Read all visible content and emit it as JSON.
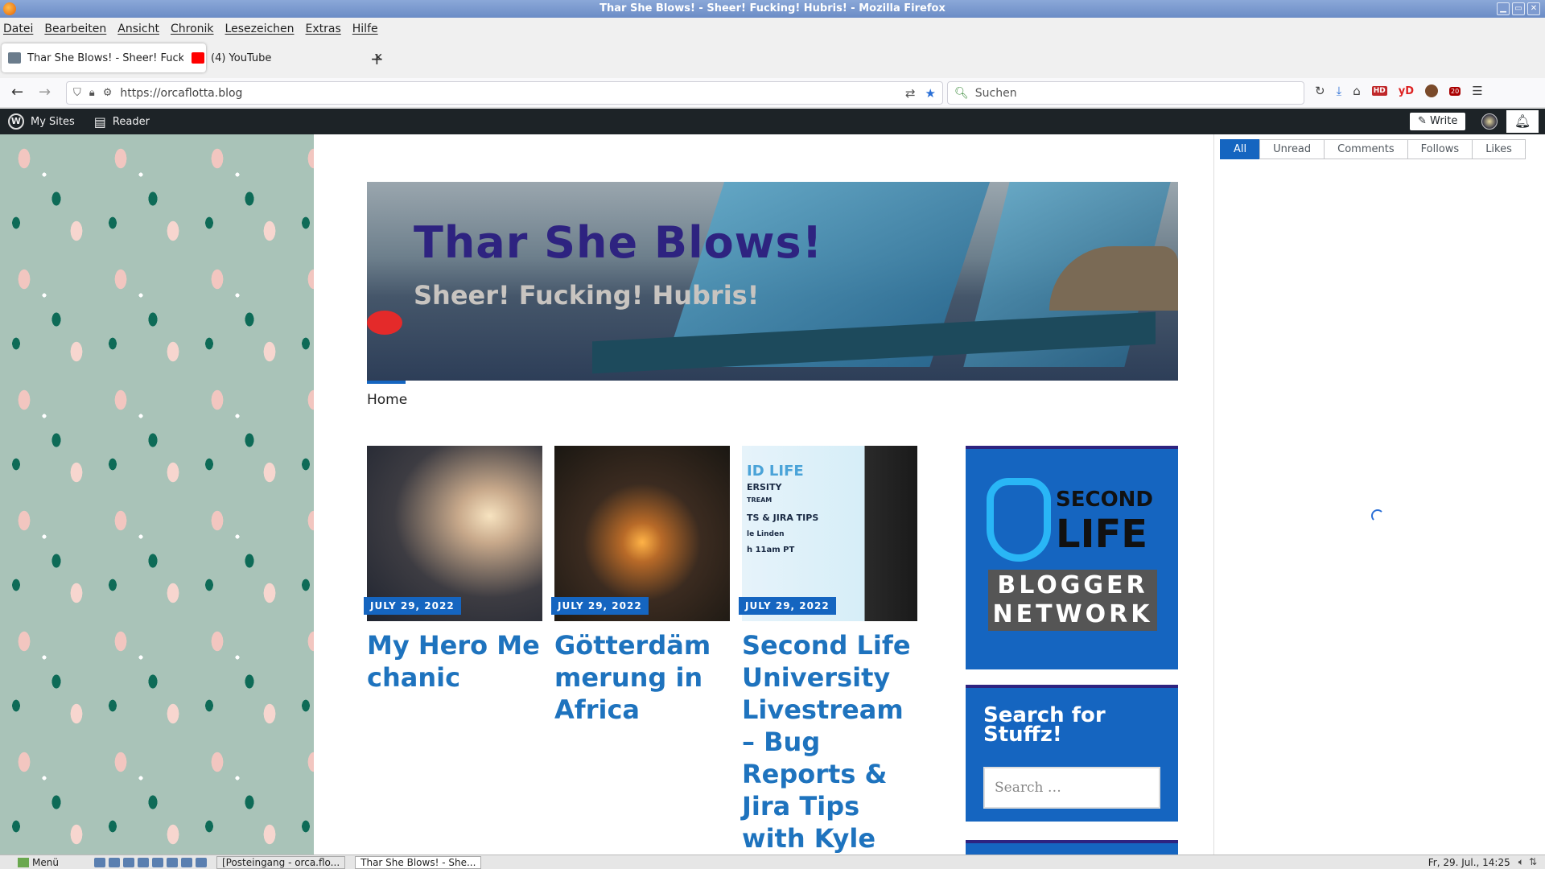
{
  "window": {
    "title": "Thar She Blows! - Sheer! Fucking! Hubris! - Mozilla Firefox"
  },
  "menu": [
    "Datei",
    "Bearbeiten",
    "Ansicht",
    "Chronik",
    "Lesezeichen",
    "Extras",
    "Hilfe"
  ],
  "tabs": [
    {
      "label": "Thar She Blows! - Sheer! Fucking! Hubris!",
      "favicon_color": "#6b7c8c"
    },
    {
      "label": "(4) YouTube",
      "favicon_color": "#ff0000"
    }
  ],
  "nav": {
    "url": "https://orcaflotta.blog",
    "search_placeholder": "Suchen"
  },
  "wpbar": {
    "my_sites": "My Sites",
    "reader": "Reader",
    "write": "Write"
  },
  "notifications": {
    "filters": [
      "All",
      "Unread",
      "Comments",
      "Follows",
      "Likes"
    ],
    "selected": "All"
  },
  "blog": {
    "title": "Thar She Blows!",
    "tagline": "Sheer! Fucking! Hubris!",
    "nav_home": "Home",
    "posts": [
      {
        "date": "JULY 29, 2022",
        "title": "My Hero Mechanic"
      },
      {
        "date": "JULY 29, 2022",
        "title": "Götterdämmerung in Africa"
      },
      {
        "date": "JULY 29, 2022",
        "title": "Second Life University Livestream – Bug Reports & Jira Tips with Kyle Linden"
      }
    ],
    "thumb3_text": {
      "line1": "ID LIFE",
      "line2": "ERSITY",
      "line3": "TREAM",
      "line4": "TS & JIRA TIPS",
      "line5": "le Linden",
      "line6": "h 11am PT"
    },
    "sl_widget": {
      "second": "SECOND",
      "life": "LIFE",
      "blogger": "BLOGGER",
      "network": "NETWORK"
    },
    "search_widget": {
      "title": "Search for Stuffz!",
      "placeholder": "Search …"
    }
  },
  "taskbar": {
    "menu": "Menü",
    "tasks": [
      "[Posteingang - orca.flo...",
      "Thar She Blows! - She..."
    ],
    "clock": "Fr, 29. Jul., 14:25"
  }
}
